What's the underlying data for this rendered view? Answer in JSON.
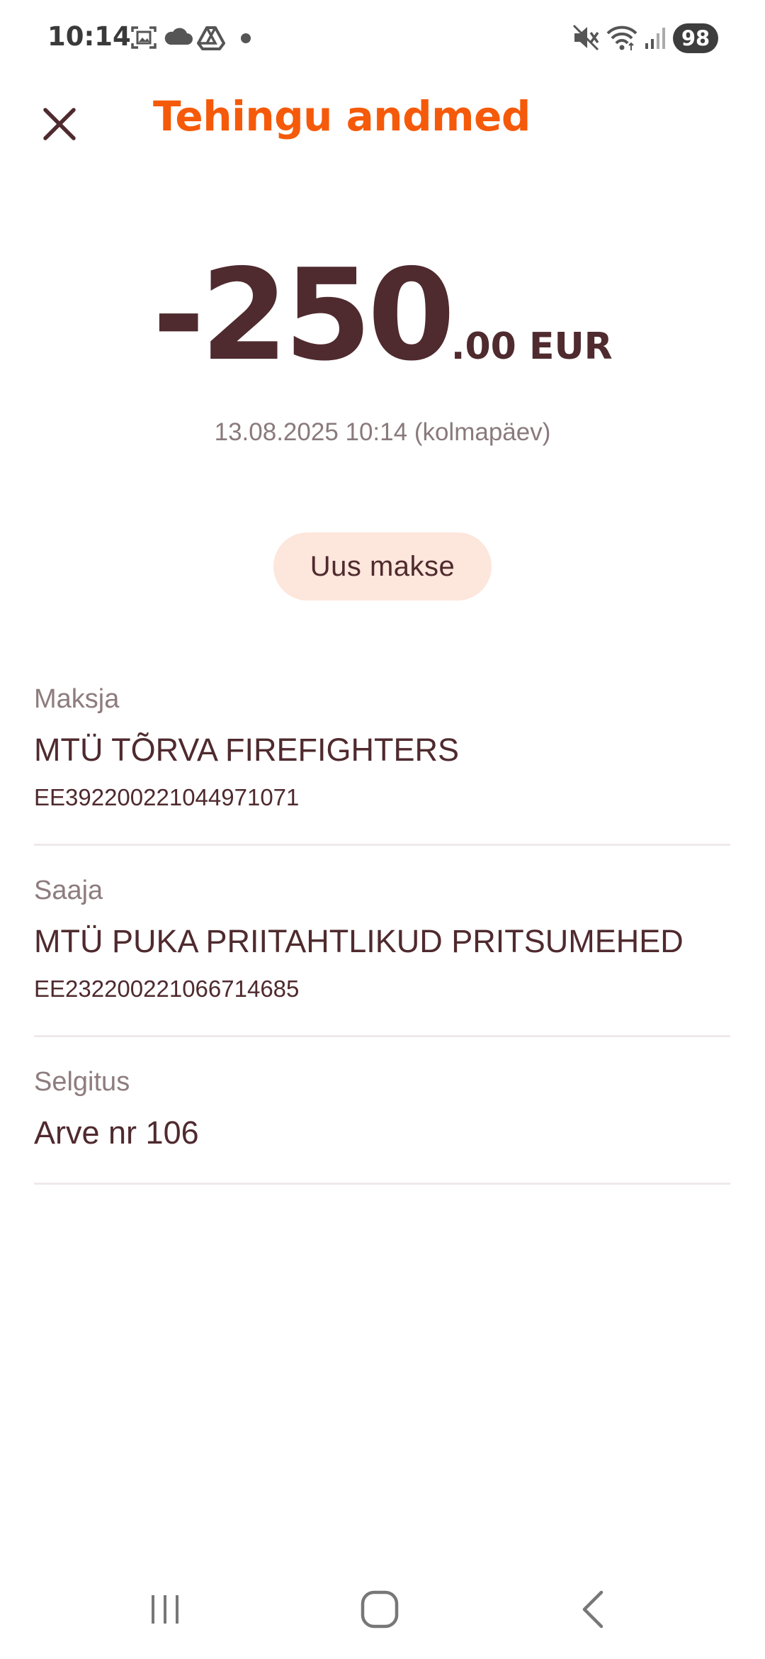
{
  "status_bar": {
    "time": "10:14",
    "battery": "98",
    "left_icons": [
      "screenshot-icon",
      "cloud-icon",
      "drive-icon",
      "notification-dot-icon"
    ],
    "right_icons": [
      "mute-icon",
      "wifi-icon",
      "signal-icon"
    ]
  },
  "header": {
    "title": "Tehingu andmed",
    "close_icon": "close-icon"
  },
  "transaction": {
    "amount_main": "-250",
    "amount_decimal": ".00",
    "currency": "EUR",
    "date": "13.08.2025 10:14 (kolmapäev)"
  },
  "actions": {
    "new_payment_label": "Uus makse"
  },
  "details": {
    "payer": {
      "label": "Maksja",
      "name": "MTÜ TÕRVA FIREFIGHTERS",
      "account": "EE392200221044971071"
    },
    "recipient": {
      "label": "Saaja",
      "name": "MTÜ PUKA PRIITAHTLIKUD PRITSUMEHED",
      "account": "EE232200221066714685"
    },
    "description": {
      "label": "Selgitus",
      "value": "Arve nr 106"
    }
  },
  "nav_bar": {
    "items": [
      "recent-apps-icon",
      "home-icon",
      "back-icon"
    ]
  },
  "colors": {
    "accent": "#f55a0a",
    "text_primary": "#4f2a2e",
    "text_secondary": "#8e7c7e",
    "button_bg": "#fde6db",
    "divider": "#efe9e9"
  }
}
